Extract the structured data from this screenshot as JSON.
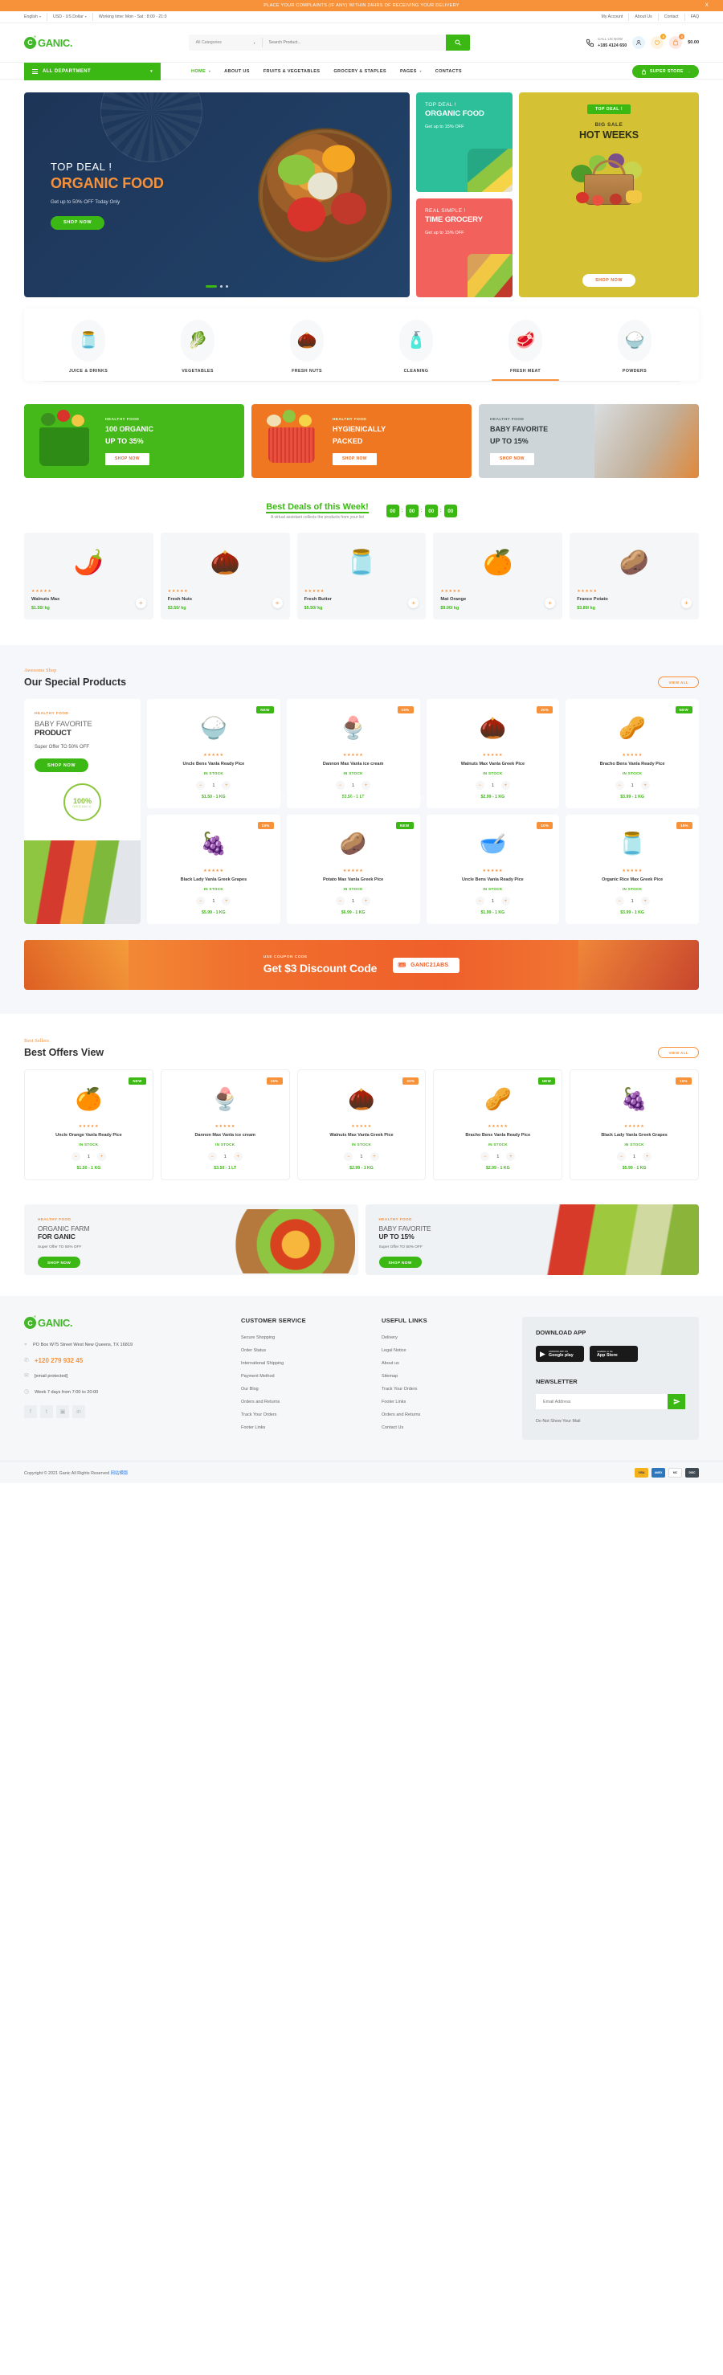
{
  "announcement": {
    "text": "PLACE YOUR COMPLAINTS (IF ANY) WITHIN 24HRS OF RECEIVING YOUR DELIVERY",
    "close": "X"
  },
  "topbar": {
    "language": "English",
    "currency": "USD - US Dollar",
    "working_time": "Working time: Mon - Sat : 8:00 - 21:0",
    "links": [
      "My Account",
      "About Us",
      "Contact",
      "FAQ"
    ]
  },
  "header": {
    "logo_letter": "C",
    "logo_text": "GANIC.",
    "search": {
      "category": "All Categories",
      "placeholder": "Search Product...",
      "value": ""
    },
    "call": {
      "label": "CALL US NOW",
      "number": "+185 4124 650"
    },
    "wishlist_count": "0",
    "cart_count": "2",
    "cart_total": "$0.00"
  },
  "nav": {
    "all_department": "ALL DEPARTMENT",
    "links": [
      {
        "label": "HOME",
        "active": true,
        "caret": true
      },
      {
        "label": "ABOUT US",
        "active": false,
        "caret": false
      },
      {
        "label": "FRUITS & VEGETABLES",
        "active": false,
        "caret": false
      },
      {
        "label": "GROCERY & STAPLES",
        "active": false,
        "caret": false
      },
      {
        "label": "PAGES",
        "active": false,
        "caret": true
      },
      {
        "label": "CONTACTS",
        "active": false,
        "caret": false
      }
    ],
    "super_store": "SUPER STORE"
  },
  "hero": {
    "main": {
      "eyebrow": "TOP DEAL !",
      "title": "ORGANIC FOOD",
      "subtitle": "Get up to 50% OFF Today Only",
      "cta": "SHOP NOW"
    },
    "teal": {
      "eyebrow": "TOP DEAL !",
      "title": "ORGANIC FOOD",
      "subtitle": "Get up to 15% OFF"
    },
    "red": {
      "eyebrow": "REAL SIMPLE !",
      "title": "TIME GROCERY",
      "subtitle": "Get up to 15% OFF"
    },
    "yellow": {
      "pill": "TOP DEAL !",
      "line1": "BIG SALE",
      "line2": "HOT WEEKS",
      "cta": "SHOP NOW"
    }
  },
  "categories": [
    {
      "label": "JUICE & DRINKS",
      "icon": "🫙",
      "active": false
    },
    {
      "label": "VEGETABLES",
      "icon": "🥬",
      "active": false
    },
    {
      "label": "FRESH NUTS",
      "icon": "🌰",
      "active": false
    },
    {
      "label": "CLEANING",
      "icon": "🧴",
      "active": false
    },
    {
      "label": "FRESH MEAT",
      "icon": "🥩",
      "active": true
    },
    {
      "label": "POWDERS",
      "icon": "🍚",
      "active": false
    }
  ],
  "promos": [
    {
      "eyebrow": "HEALTHY FOOD",
      "line1": "100 ORGANIC",
      "line2": "UP TO 35%",
      "cta": "SHOP NOW",
      "theme": "green"
    },
    {
      "eyebrow": "HEALTHY FOOD",
      "line1": "HYGIENICALLY",
      "line2": "PACKED",
      "cta": "SHOP NOW",
      "theme": "orange"
    },
    {
      "eyebrow": "HEALTHY FOOD",
      "line1": "BABY FAVORITE",
      "line2": "UP TO 15%",
      "cta": "SHOP NOW",
      "theme": "grey"
    }
  ],
  "best_deals": {
    "title_a": "Best Deals ",
    "title_b": "of this Week!",
    "subtitle": "A virtual assistant collects the products from your list",
    "countdown": [
      "00",
      "00",
      "00",
      "00"
    ],
    "separator": ":",
    "products": [
      {
        "name": "Walnuts Max",
        "price": "$1.50/ kg",
        "stars": "★★★★★",
        "icon": "🌶️",
        "plus": "+"
      },
      {
        "name": "Fresh Nuts",
        "price": "$3.50/ kg",
        "stars": "★★★★★",
        "icon": "🌰",
        "plus": "+"
      },
      {
        "name": "Fresh Butter",
        "price": "$5.50/ kg",
        "stars": "★★★★★",
        "icon": "🫙",
        "plus": "+"
      },
      {
        "name": "Mat Orange",
        "price": "$9.00/ kg",
        "stars": "★★★★★",
        "icon": "🍊",
        "plus": "+"
      },
      {
        "name": "France Potato",
        "price": "$3.89/ kg",
        "stars": "★★★★★",
        "icon": "🥔",
        "plus": "+"
      }
    ]
  },
  "special": {
    "eyebrow": "Awesome Shop",
    "title": "Our Special Products",
    "view_all": "VIEW ALL",
    "banner": {
      "eyebrow": "HEALTHY FOOD",
      "line1": "BABY FAVORITE",
      "line2": "PRODUCT",
      "subtitle": "Super Offer TO 50% OFF",
      "cta": "SHOP NOW",
      "seal_top": "100%",
      "seal_bottom": "ORGANIC"
    },
    "products": [
      {
        "name": "Uncle Bens Vanla Ready Pice",
        "badge": "NEW",
        "badge_type": "new",
        "stock": "IN STOCK",
        "qty": "1",
        "price": "$1.50 - 1 KG",
        "icon": "🍚",
        "minus": "−",
        "plus": "+"
      },
      {
        "name": "Dannon Max Vanla ice cream",
        "badge": "15%",
        "badge_type": "off",
        "stock": "IN STOCK",
        "qty": "1",
        "price": "$3.50 - 1 LT",
        "icon": "🍨",
        "minus": "−",
        "plus": "+"
      },
      {
        "name": "Walnuts Max Vanla Greek Pice",
        "badge": "30%",
        "badge_type": "off",
        "stock": "IN STOCK",
        "qty": "1",
        "price": "$2.99 - 1 KG",
        "icon": "🌰",
        "minus": "−",
        "plus": "+"
      },
      {
        "name": "Bracho Bens Vanla Ready Pice",
        "badge": "NEW",
        "badge_type": "new",
        "stock": "IN STOCK",
        "qty": "1",
        "price": "$3.99 - 1 KG",
        "icon": "🥜",
        "minus": "−",
        "plus": "+"
      },
      {
        "name": "Black Lady Vanla Greek Grapes",
        "badge": "15%",
        "badge_type": "off",
        "stock": "IN STOCK",
        "qty": "1",
        "price": "$5.99 - 1 KG",
        "icon": "🍇",
        "minus": "−",
        "plus": "+"
      },
      {
        "name": "Potato Max Vanla Greek Pice",
        "badge": "NEW",
        "badge_type": "new",
        "stock": "IN STOCK",
        "qty": "1",
        "price": "$6.99 - 1 KG",
        "icon": "🥔",
        "minus": "−",
        "plus": "+"
      },
      {
        "name": "Uncle Bens Vanla Ready Pice",
        "badge": "10%",
        "badge_type": "off",
        "stock": "IN STOCK",
        "qty": "1",
        "price": "$1.99 - 1 KG",
        "icon": "🥣",
        "minus": "−",
        "plus": "+"
      },
      {
        "name": "Organic Rice Max Greek Pice",
        "badge": "15%",
        "badge_type": "off",
        "stock": "IN STOCK",
        "qty": "1",
        "price": "$3.99 - 1 KG",
        "icon": "🫙",
        "minus": "−",
        "plus": "+"
      }
    ]
  },
  "coupon": {
    "eyebrow": "USE COUPON CODE",
    "title": "Get $3 Discount Code",
    "code": "GANIC21ABS"
  },
  "best_sellers": {
    "eyebrow": "Best Sellers",
    "title": "Best Offers View",
    "view_all": "VIEW ALL",
    "products": [
      {
        "name": "Uncle Orange Vanla Ready Pice",
        "badge": "NEW",
        "badge_type": "new",
        "stock": "IN STOCK",
        "qty": "1",
        "price": "$1.50 - 1 KG",
        "icon": "🍊",
        "minus": "−",
        "plus": "+"
      },
      {
        "name": "Dannon Max Vanla ice cream",
        "badge": "15%",
        "badge_type": "off",
        "stock": "IN STOCK",
        "qty": "1",
        "price": "$3.50 - 1 LT",
        "icon": "🍨",
        "minus": "−",
        "plus": "+"
      },
      {
        "name": "Walnuts Max Vanla Greek Pice",
        "badge": "30%",
        "badge_type": "off",
        "stock": "IN STOCK",
        "qty": "1",
        "price": "$2.99 - 1 KG",
        "icon": "🌰",
        "minus": "−",
        "plus": "+"
      },
      {
        "name": "Bracho Bens Vanla Ready Pice",
        "badge": "NEW",
        "badge_type": "new",
        "stock": "IN STOCK",
        "qty": "1",
        "price": "$2.99 - 1 KG",
        "icon": "🥜",
        "minus": "−",
        "plus": "+"
      },
      {
        "name": "Black Lady Vanla Greek Grapes",
        "badge": "15%",
        "badge_type": "off",
        "stock": "IN STOCK",
        "qty": "1",
        "price": "$5.99 - 1 KG",
        "icon": "🍇",
        "minus": "−",
        "plus": "+"
      }
    ]
  },
  "bottom_banners": [
    {
      "eyebrow": "HEALTHY FOOD",
      "line1": "ORGANIC FARM",
      "line2": "FOR GANIC",
      "subtitle": "Super Offer TO 50% OFF",
      "cta": "SHOP NOW"
    },
    {
      "eyebrow": "HEALTHY FOOD",
      "line1": "BABY FAVORITE",
      "line2": "UP TO 15%",
      "subtitle": "Super Offer TO 50% OFF",
      "cta": "SHOP NOW"
    }
  ],
  "footer": {
    "logo_letter": "C",
    "logo_text": "GANIC.",
    "address": "PO Box W75 Street West New Queens, TX 16819",
    "phone": "+120 279 932 45",
    "email": "[email protected]",
    "hours": "Week 7 days from 7:00 to 20:00",
    "social": [
      "f",
      "t",
      "▣",
      "in"
    ],
    "customer_service": {
      "title": "CUSTOMER SERVICE",
      "links": [
        "Secure Shopping",
        "Order Status",
        "International Shipping",
        "Payment Method",
        "Our Blog",
        "Orders and Returns",
        "Track Your Orders",
        "Footer Links"
      ]
    },
    "useful_links": {
      "title": "USEFUL LINKS",
      "links": [
        "Delivery",
        "Legal Notice",
        "About us",
        "Sitemap",
        "Track Your Orders",
        "Footer Links",
        "Orders and Returns",
        "Contact Us"
      ]
    },
    "download_app": {
      "title": "DOWNLOAD APP",
      "google_small": "ANDROID APP ON",
      "google_big": "Google play",
      "apple_small": "Available on the",
      "apple_big": "App Store"
    },
    "newsletter": {
      "title": "NEWSLETTER",
      "placeholder": "Email Address",
      "value": "",
      "note": "Do Not Show Your Mail"
    },
    "copyright": "Copyright © 2021 Ganic All Rights Reserved ",
    "copyright_link": "网站模版",
    "payments": [
      "VISA",
      "AMEX",
      "MC",
      "DISC"
    ]
  },
  "watermark": "https://www.huzhan.com/ishop1299",
  "colors": {
    "green": "#3cb815",
    "orange": "#f7913a",
    "navy": "#1d3557",
    "teal": "#2dbf9a",
    "red": "#f2615c",
    "yellow": "#d4c234"
  }
}
